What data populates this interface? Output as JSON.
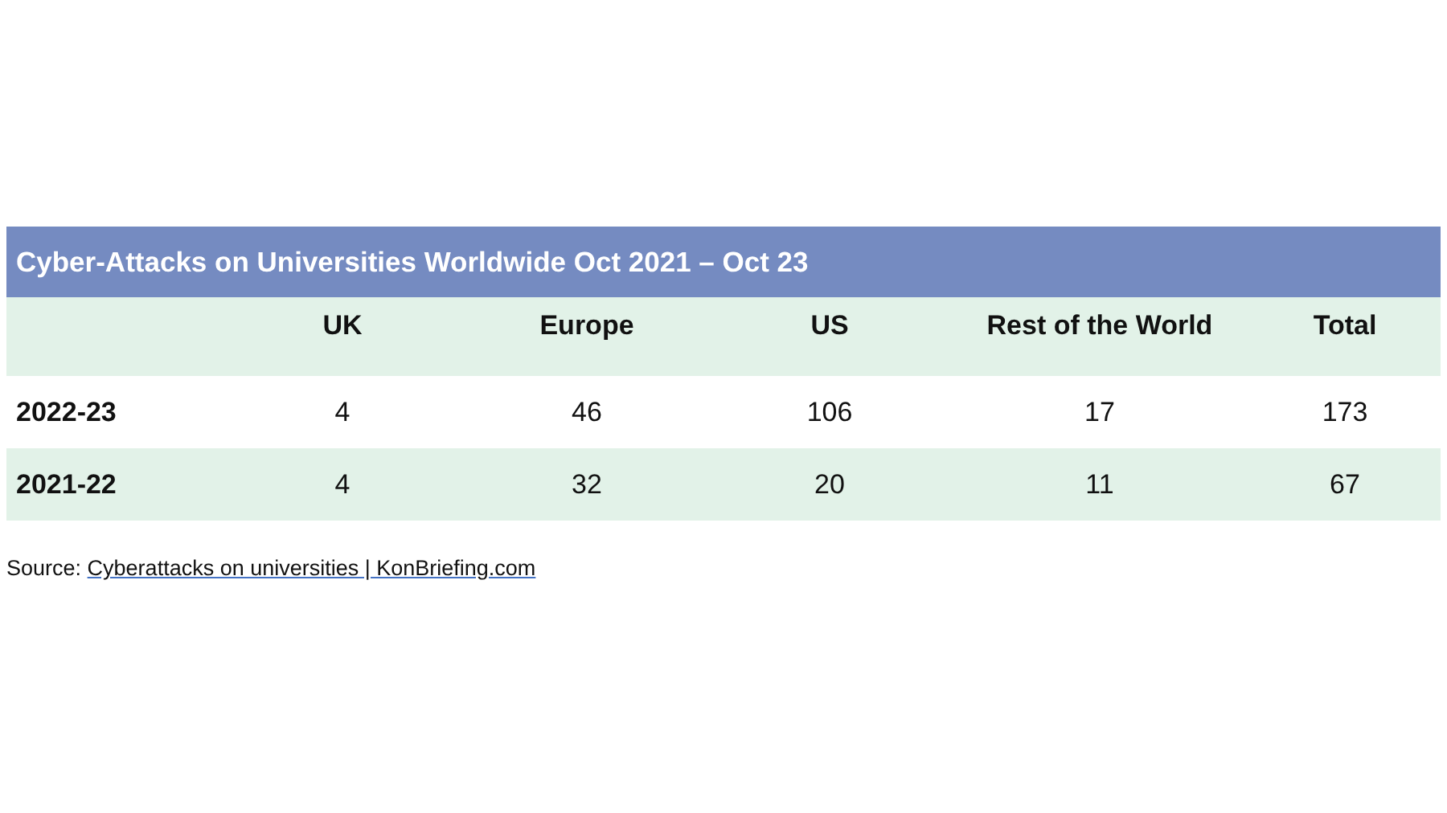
{
  "table": {
    "title": "Cyber-Attacks on Universities Worldwide Oct 2021 – Oct 23",
    "columns": [
      "",
      "UK",
      "Europe",
      "US",
      "Rest of the World",
      "Total"
    ],
    "rows": [
      {
        "cells": [
          "2022-23",
          "4",
          "46",
          "106",
          "17",
          "173"
        ]
      },
      {
        "cells": [
          "2021-22",
          "4",
          "32",
          "20",
          "11",
          "67"
        ]
      }
    ]
  },
  "source": {
    "label": "Source:",
    "link": "Cyberattacks on universities | KonBriefing.com"
  }
}
